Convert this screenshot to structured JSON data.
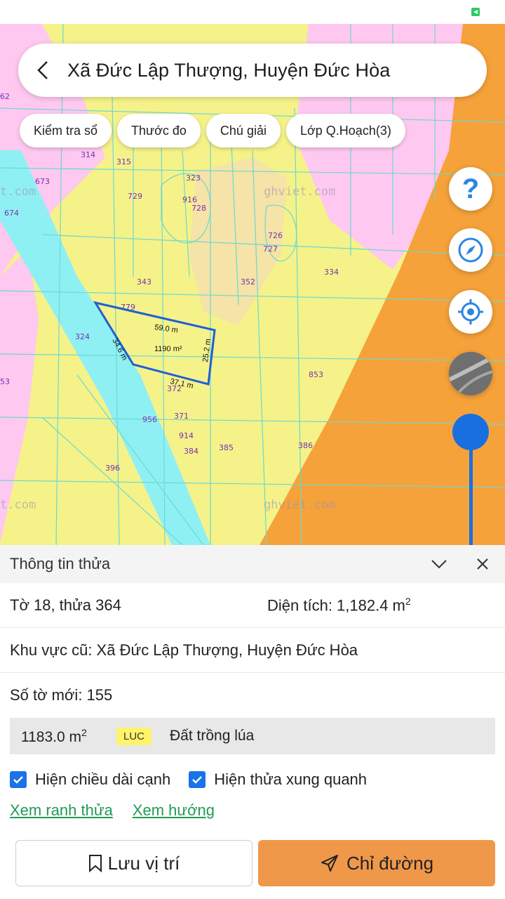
{
  "header": {
    "title": "Xã Đức Lập Thượng, Huyện Đức Hòa"
  },
  "chips": [
    "Kiểm tra sổ",
    "Thước đo",
    "Chú giải",
    "Lớp Q.Hoạch(3)"
  ],
  "map": {
    "watermarks": [
      "ghviet.com",
      "ghviet.com",
      "t.com",
      "t.com"
    ],
    "parcel_numbers": [
      "314",
      "315",
      "323",
      "673",
      "729",
      "916",
      "728",
      "674",
      "726",
      "727",
      "334",
      "343",
      "352",
      "779",
      "324",
      "853",
      "372",
      "956",
      "371",
      "914",
      "384",
      "385",
      "386",
      "396",
      "62",
      "53"
    ],
    "selected_parcel": {
      "area_label": "1190 m²",
      "edges": [
        "59.0 m",
        "25.2 m",
        "37.1 m",
        "34.6 m"
      ]
    },
    "colors": {
      "residential": "#f5f28a",
      "commercial": "#f6a23a",
      "urban": "#ffc8f0",
      "water": "#8ff0f3",
      "parcel_outline": "#1f5fd8",
      "grid_lines": "#6cd9d0"
    }
  },
  "controls": {
    "help_icon": "question-icon",
    "compass_icon": "compass-icon",
    "locate_icon": "crosshair-icon",
    "layer_icon": "satellite-thumbnail"
  },
  "panel": {
    "title": "Thông tin thửa",
    "sheet_plot": "Tờ 18, thửa 364",
    "area_label": "Diện tích: 1,182.4 m",
    "area_sup": "2",
    "old_area": "Khu vực cũ: Xã Đức Lập Thượng, Huyện Đức Hòa",
    "new_sheet": "Số tờ mới: 155",
    "landuse": {
      "area": "1183.0 m",
      "area_sup": "2",
      "code": "LUC",
      "name": "Đất trồng lúa"
    },
    "checkboxes": [
      {
        "label": "Hiện chiều dài cạnh",
        "checked": true
      },
      {
        "label": "Hiện thửa xung quanh",
        "checked": true
      }
    ],
    "links": [
      "Xem ranh thửa",
      "Xem hướng"
    ],
    "buttons": {
      "save": "Lưu vị trí",
      "route": "Chỉ đường"
    }
  }
}
